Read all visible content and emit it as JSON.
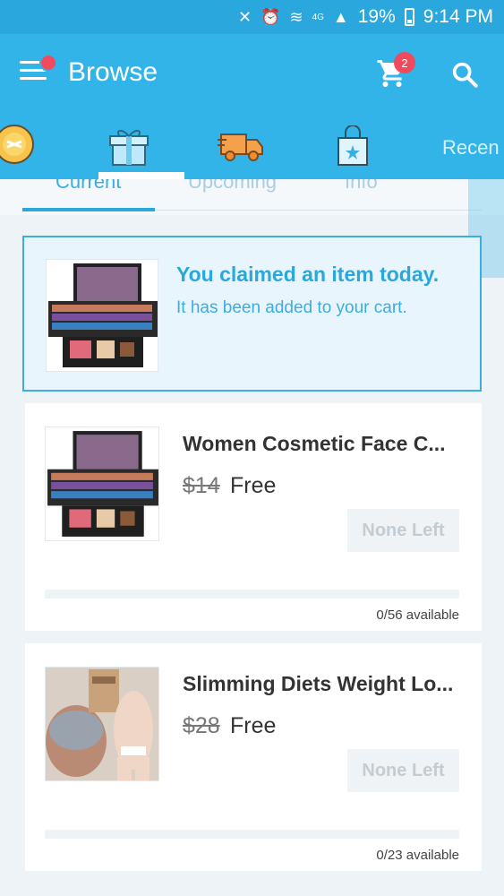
{
  "status_bar": {
    "battery": "19%",
    "time": "9:14 PM",
    "network": "4G"
  },
  "app_bar": {
    "title": "Browse",
    "cart_count": "2"
  },
  "category_bar": {
    "recent_label": "Recen"
  },
  "sub_tabs": [
    {
      "label": "Current"
    },
    {
      "label": "Upcoming"
    },
    {
      "label": "Info"
    }
  ],
  "claim_banner": {
    "title": "You claimed an item today.",
    "subtitle": "It has been added to your cart."
  },
  "products": [
    {
      "name": "Women Cosmetic Face C...",
      "old_price": "$14",
      "price": "Free",
      "button": "None Left",
      "availability": "0/56 available",
      "claimed_fraction": 0
    },
    {
      "name": "Slimming Diets Weight Lo...",
      "old_price": "$28",
      "price": "Free",
      "button": "None Left",
      "availability": "0/23 available",
      "claimed_fraction": 0
    }
  ],
  "colors": {
    "primary": "#33b4e8",
    "badge": "#ef4b5c",
    "accent": "#2aa8de"
  },
  "icons": [
    "signal-icon",
    "alarm-icon",
    "wifi-icon",
    "battery-icon",
    "menu-icon",
    "cart-icon",
    "search-icon",
    "coin-icon",
    "gift-icon",
    "truck-icon",
    "shopping-bag-icon"
  ]
}
